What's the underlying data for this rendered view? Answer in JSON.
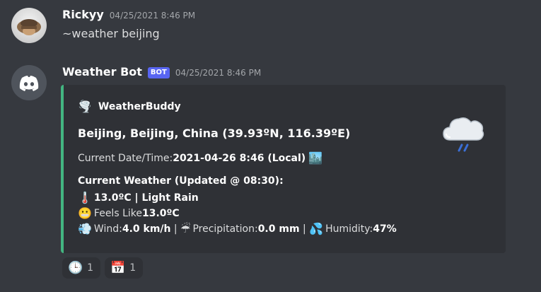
{
  "messages": [
    {
      "username": "Rickyy",
      "timestamp": "04/25/2021 8:46 PM",
      "content": "~weather beijing"
    },
    {
      "username": "Weather Bot",
      "badge": "BOT",
      "timestamp": "04/25/2021 8:46 PM",
      "embed": {
        "accent_color": "#43b581",
        "author_icon": "🌪️",
        "author_name": "WeatherBuddy",
        "title": "Beijing, Beijing, China (39.93ºN, 116.39ºE)",
        "datetime_label": "Current Date/Time: ",
        "datetime_value": "2021-04-26 8:46 (Local)",
        "datetime_icon": "🏙️",
        "current_weather_header": "Current Weather (Updated @ 08:30):",
        "temp_icon": "🌡️",
        "temp_condition": "13.0ºC | Light Rain",
        "feels_icon": "😬",
        "feels_label": "Feels Like ",
        "feels_value": "13.0ºC",
        "wind_icon": "💨",
        "wind_label": "Wind: ",
        "wind_value": "4.0 km/h",
        "separator": " | ",
        "precip_icon": "☔",
        "precip_label": "Precipitation: ",
        "precip_value": "0.0 mm",
        "humidity_icon": "💦",
        "humidity_label": "Humidity: ",
        "humidity_value": "47%",
        "thumbnail_icon": "rain-cloud-icon"
      }
    }
  ],
  "reactions": [
    {
      "emoji": "🕒",
      "count": "1"
    },
    {
      "emoji": "📅",
      "count": "1"
    }
  ]
}
